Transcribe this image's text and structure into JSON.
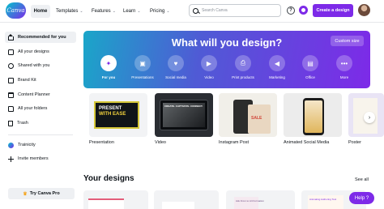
{
  "header": {
    "logo_text": "Canva",
    "nav": {
      "home": "Home",
      "templates": "Templates",
      "features": "Features",
      "learn": "Learn",
      "pricing": "Pricing"
    },
    "search_placeholder": "Search Canva",
    "help_glyph": "?",
    "create_label": "Create a design"
  },
  "sidebar": {
    "items": [
      {
        "label": "Recommended for you",
        "icon": "house-icon"
      },
      {
        "label": "All your designs",
        "icon": "designs-icon"
      },
      {
        "label": "Shared with you",
        "icon": "shared-icon"
      },
      {
        "label": "Brand Kit",
        "icon": "brand-kit-icon"
      },
      {
        "label": "Content Planner",
        "icon": "calendar-icon"
      },
      {
        "label": "All your folders",
        "icon": "folder-icon"
      },
      {
        "label": "Trash",
        "icon": "trash-icon"
      }
    ],
    "team": "Trainicity",
    "invite": "Invite members",
    "pro": "Try Canva Pro"
  },
  "hero": {
    "title": "What will you design?",
    "custom_size": "Custom size",
    "categories": [
      {
        "label": "For you",
        "icon": "sparkle-icon"
      },
      {
        "label": "Presentations",
        "icon": "presentation-icon"
      },
      {
        "label": "Social media",
        "icon": "heart-icon"
      },
      {
        "label": "Video",
        "icon": "video-icon"
      },
      {
        "label": "Print products",
        "icon": "print-icon"
      },
      {
        "label": "Marketing",
        "icon": "megaphone-icon"
      },
      {
        "label": "Office",
        "icon": "briefcase-icon"
      },
      {
        "label": "More",
        "icon": "more-icon"
      }
    ]
  },
  "design_types": {
    "items": [
      {
        "label": "Presentation",
        "thumb_text_1": "PRESENT",
        "thumb_text_2": "WITH EASE"
      },
      {
        "label": "Video",
        "thumb_text": "CREATE. CAPTIVATE. CONNECT."
      },
      {
        "label": "Instagram Post",
        "thumb_text": "SALE"
      },
      {
        "label": "Animated Social Media"
      },
      {
        "label": "Poster"
      }
    ],
    "next_glyph": "›"
  },
  "your_designs": {
    "title": "Your designs",
    "see_all": "See all",
    "thumb3_text": "Ask From to Art Formation",
    "thumb4_text": "Animating Authoring Tool"
  },
  "help_button": "Help ?",
  "colors": {
    "accent": "#7d2ae8",
    "hero_start": "#1aa6c9",
    "hero_end": "#7d2ae8"
  }
}
